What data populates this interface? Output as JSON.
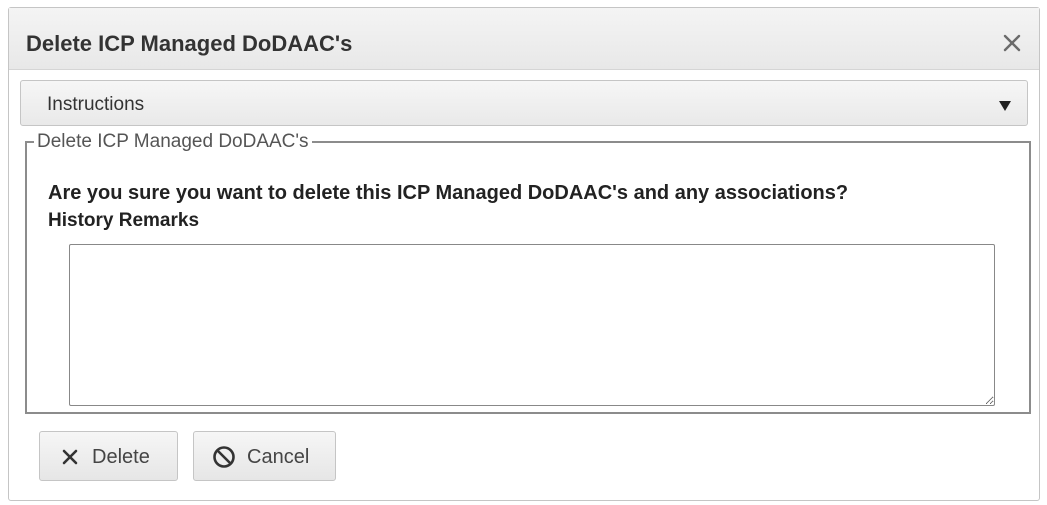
{
  "dialog": {
    "title": "Delete ICP Managed DoDAAC's",
    "close_icon": "close-icon"
  },
  "accordion": {
    "label": "Instructions",
    "arrow_icon": "caret-down-icon"
  },
  "form": {
    "legend": "Delete ICP Managed DoDAAC's",
    "question": "Are you sure you want to delete this ICP Managed DoDAAC's and any associations?",
    "remarks_label": "History Remarks",
    "remarks_value": ""
  },
  "buttons": {
    "delete_label": "Delete",
    "delete_icon": "x-icon",
    "cancel_label": "Cancel",
    "cancel_icon": "ban-icon"
  }
}
